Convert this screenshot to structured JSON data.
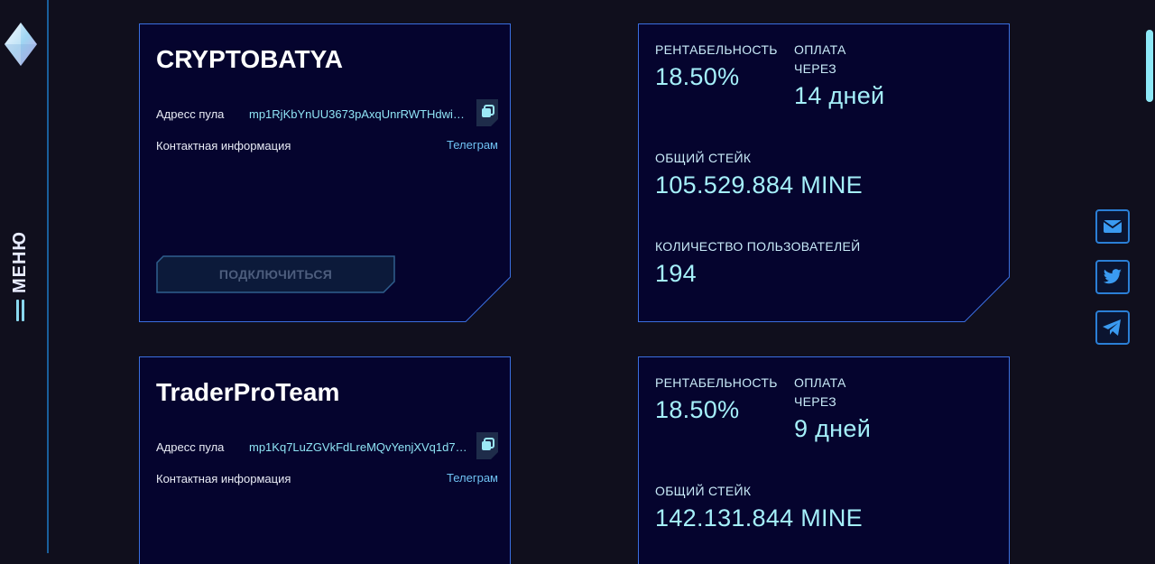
{
  "sidebar": {
    "menu_label": "МЕНЮ"
  },
  "pools": [
    {
      "name": "CRYPTOBATYA",
      "address_label": "Адресс пула",
      "address_value": "mp1RjKbYnUU3673pAxqUnrRWTHdwi…",
      "contact_label": "Контактная информация",
      "contact_link": "Телеграм",
      "connect_label": "ПОДКЛЮЧИТЬСЯ",
      "stats": {
        "profit_label": "РЕНТАБЕЛЬНОСТЬ",
        "profit_value": "18.50%",
        "payment_label_1": "ОПЛАТА",
        "payment_label_2": "ЧЕРЕЗ",
        "payment_value": "14 дней",
        "stake_label": "ОБЩИЙ СТЕЙК",
        "stake_value": "105.529.884 MINE",
        "users_label": "КОЛИЧЕСТВО ПОЛЬЗОВАТЕЛЕЙ",
        "users_value": "194"
      }
    },
    {
      "name": "TraderProTeam",
      "address_label": "Адресс пула",
      "address_value": "mp1Kq7LuZGVkFdLreMQvYenjXVq1d71…",
      "contact_label": "Контактная информация",
      "contact_link": "Телеграм",
      "stats": {
        "profit_label": "РЕНТАБЕЛЬНОСТЬ",
        "profit_value": "18.50%",
        "payment_label_1": "ОПЛАТА",
        "payment_label_2": "ЧЕРЕЗ",
        "payment_value": "9 дней",
        "stake_label": "ОБЩИЙ СТЕЙК",
        "stake_value": "142.131.844 MINE"
      }
    }
  ],
  "social": [
    "mail-icon",
    "twitter-icon",
    "telegram-icon"
  ],
  "colors": {
    "background": "#100f1d",
    "panel": "#05042e",
    "border": "#3a6ee0",
    "accent": "#a5f0fa",
    "link": "#6fc2f3"
  }
}
